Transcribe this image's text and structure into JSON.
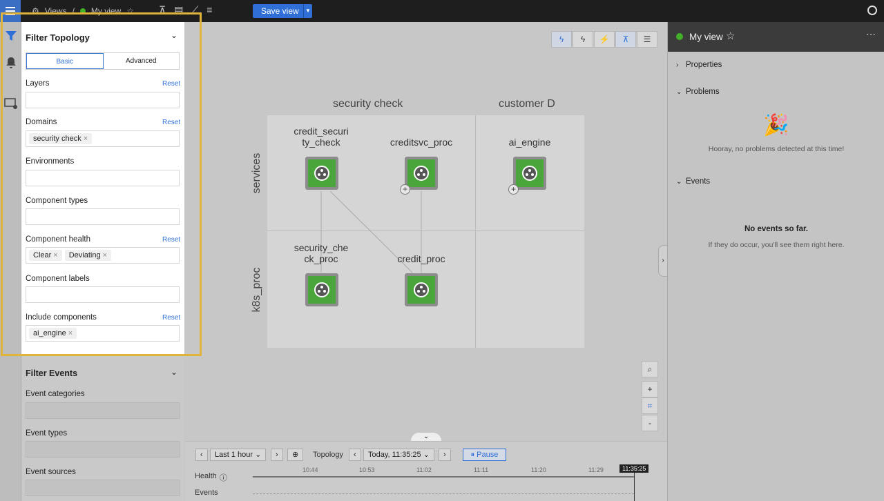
{
  "topbar": {
    "breadcrumb_root": "Views",
    "breadcrumb_current": "My view",
    "save_label": "Save view"
  },
  "filter_topology": {
    "title": "Filter Topology",
    "tabs": [
      "Basic",
      "Advanced"
    ],
    "layers_label": "Layers",
    "domains_label": "Domains",
    "domains_chips": [
      "security check"
    ],
    "environments_label": "Environments",
    "component_types_label": "Component types",
    "component_health_label": "Component health",
    "component_health_chips": [
      "Clear",
      "Deviating"
    ],
    "component_labels_label": "Component labels",
    "include_components_label": "Include components",
    "include_components_chips": [
      "ai_engine"
    ],
    "reset_label": "Reset"
  },
  "filter_events": {
    "title": "Filter Events",
    "fields": [
      "Event categories",
      "Event types",
      "Event sources"
    ]
  },
  "topology": {
    "columns": [
      "security check",
      "customer D"
    ],
    "rows": [
      "services",
      "k8s_proc"
    ],
    "nodes": [
      "credit_securi\nty_check",
      "creditsvc_proc",
      "ai_engine",
      "security_che\nck_proc",
      "credit_proc"
    ],
    "node_label_lines": {
      "credit_security_check": [
        "credit_securi",
        "ty_check"
      ],
      "security_check_proc": [
        "security_che",
        "ck_proc"
      ]
    }
  },
  "timeline": {
    "range": "Last 1 hour",
    "mode": "Topology",
    "time": "Today, 11:35:25",
    "pause": "Pause",
    "health_label": "Health",
    "events_label": "Events",
    "ticks": [
      "10:44",
      "10:53",
      "11:02",
      "11:11",
      "11:20",
      "11:29"
    ],
    "now": "11:35:25"
  },
  "right_panel": {
    "title": "My view",
    "properties": "Properties",
    "problems": "Problems",
    "no_problems": "Hooray, no problems detected at this time!",
    "events": "Events",
    "no_events": "No events so far.",
    "no_events_sub": "If they do occur, you'll see them right here."
  },
  "colors": {
    "accent": "#2f6fd6",
    "healthy": "#43b02a",
    "highlight": "#e0b43a"
  }
}
